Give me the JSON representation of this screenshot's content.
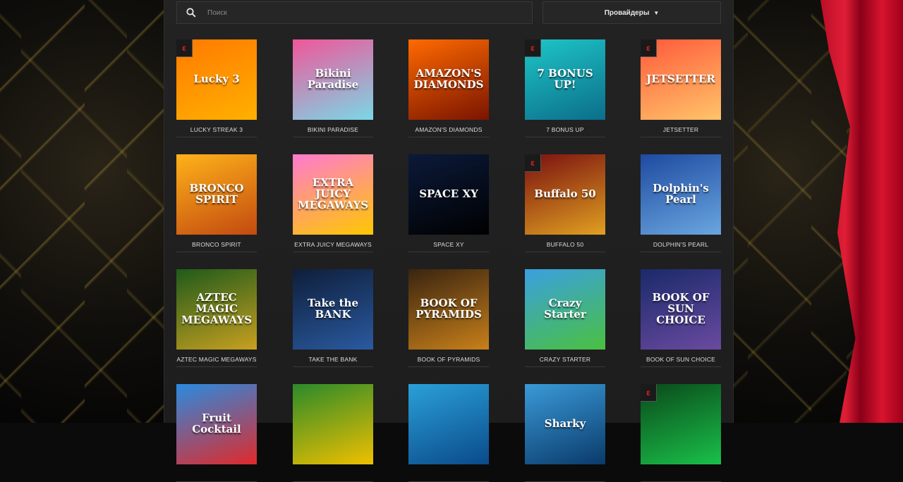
{
  "search": {
    "placeholder": "Поиск"
  },
  "providers": {
    "label": "Провайдеры"
  },
  "games": [
    {
      "title": "LUCKY STREAK 3",
      "art": "Lucky 3",
      "badge": true,
      "colors": [
        "#ff7a00",
        "#ffb000"
      ]
    },
    {
      "title": "BIKINI PARADISE",
      "art": "Bikini Paradise",
      "badge": false,
      "colors": [
        "#f0569a",
        "#7ad8e6"
      ]
    },
    {
      "title": "AMAZON'S DIAMONDS",
      "art": "AMAZON'S DIAMONDS",
      "badge": false,
      "colors": [
        "#ff6a00",
        "#7a1400"
      ]
    },
    {
      "title": "7 BONUS UP",
      "art": "7 BONUS UP!",
      "badge": true,
      "colors": [
        "#1ec6c8",
        "#0b6e8a"
      ]
    },
    {
      "title": "JETSETTER",
      "art": "JETSETTER",
      "badge": true,
      "colors": [
        "#ff5a3a",
        "#ffc46a"
      ]
    },
    {
      "title": "BRONCO SPIRIT",
      "art": "BRONCO SPIRIT",
      "badge": false,
      "colors": [
        "#ffb21a",
        "#c24a10"
      ]
    },
    {
      "title": "EXTRA JUICY MEGAWAYS",
      "art": "EXTRA JUICY MEGAWAYS",
      "badge": false,
      "colors": [
        "#ff7ad0",
        "#ffc800"
      ]
    },
    {
      "title": "SPACE XY",
      "art": "SPACE XY",
      "badge": false,
      "colors": [
        "#0b1a3a",
        "#000000"
      ]
    },
    {
      "title": "BUFFALO 50",
      "art": "Buffalo 50",
      "badge": true,
      "colors": [
        "#7a1010",
        "#e0a020"
      ]
    },
    {
      "title": "DOLPHIN'S PEARL",
      "art": "Dolphin's Pearl",
      "badge": false,
      "colors": [
        "#1e4aa0",
        "#6aa6e0"
      ]
    },
    {
      "title": "AZTEC MAGIC MEGAWAYS",
      "art": "AZTEC MAGIC MEGAWAYS",
      "badge": false,
      "colors": [
        "#1f5a1a",
        "#c8a020"
      ]
    },
    {
      "title": "TAKE THE BANK",
      "art": "Take the BANK",
      "badge": false,
      "colors": [
        "#0e1e3a",
        "#2a5aa0"
      ]
    },
    {
      "title": "BOOK OF PYRAMIDS",
      "art": "BOOK OF PYRAMIDS",
      "badge": false,
      "colors": [
        "#3a2410",
        "#c8801a"
      ]
    },
    {
      "title": "CRAZY STARTER",
      "art": "Crazy Starter",
      "badge": false,
      "colors": [
        "#3aa0e0",
        "#4ac040"
      ]
    },
    {
      "title": "BOOK OF SUN CHOICE",
      "art": "BOOK OF SUN CHOICE",
      "badge": false,
      "colors": [
        "#1a2a6a",
        "#6a4aa0"
      ]
    },
    {
      "title": "",
      "art": "Fruit Cocktail",
      "badge": false,
      "colors": [
        "#2a8ae0",
        "#e02a2a"
      ]
    },
    {
      "title": "",
      "art": "",
      "badge": false,
      "colors": [
        "#2a8a2a",
        "#f0c000"
      ]
    },
    {
      "title": "",
      "art": "",
      "badge": false,
      "colors": [
        "#2aa0d8",
        "#0a4a8a"
      ]
    },
    {
      "title": "",
      "art": "Sharky",
      "badge": false,
      "colors": [
        "#3a9ad8",
        "#0a3a6a"
      ]
    },
    {
      "title": "",
      "art": "",
      "badge": true,
      "colors": [
        "#0a4a1a",
        "#1ac04a"
      ]
    }
  ]
}
